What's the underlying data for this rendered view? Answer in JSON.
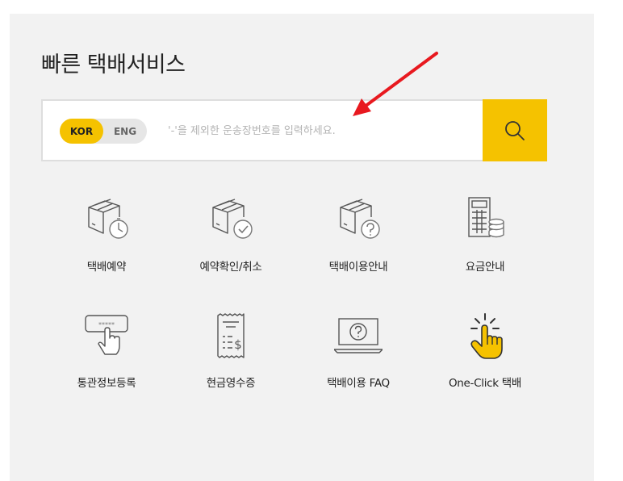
{
  "header": {
    "title": "빠른 택배서비스"
  },
  "search": {
    "lang_kor": "KOR",
    "lang_eng": "ENG",
    "placeholder": "'-'을 제외한 운송장번호를 입력하세요.",
    "value": ""
  },
  "menu": {
    "items": [
      {
        "label": "택배예약",
        "icon": "box-timer-icon"
      },
      {
        "label": "예약확인/취소",
        "icon": "box-check-icon"
      },
      {
        "label": "택배이용안내",
        "icon": "box-question-icon"
      },
      {
        "label": "요금안내",
        "icon": "calculator-coins-icon"
      },
      {
        "label": "통관정보등록",
        "icon": "password-touch-icon"
      },
      {
        "label": "현금영수증",
        "icon": "receipt-icon"
      },
      {
        "label": "택배이용 FAQ",
        "icon": "laptop-question-icon"
      },
      {
        "label": "One-Click 택배",
        "icon": "click-hand-icon"
      }
    ]
  },
  "colors": {
    "accent": "#f5c200",
    "panel": "#f2f2f2",
    "icon_stroke": "#555555",
    "annotation_arrow": "#e8191f"
  }
}
